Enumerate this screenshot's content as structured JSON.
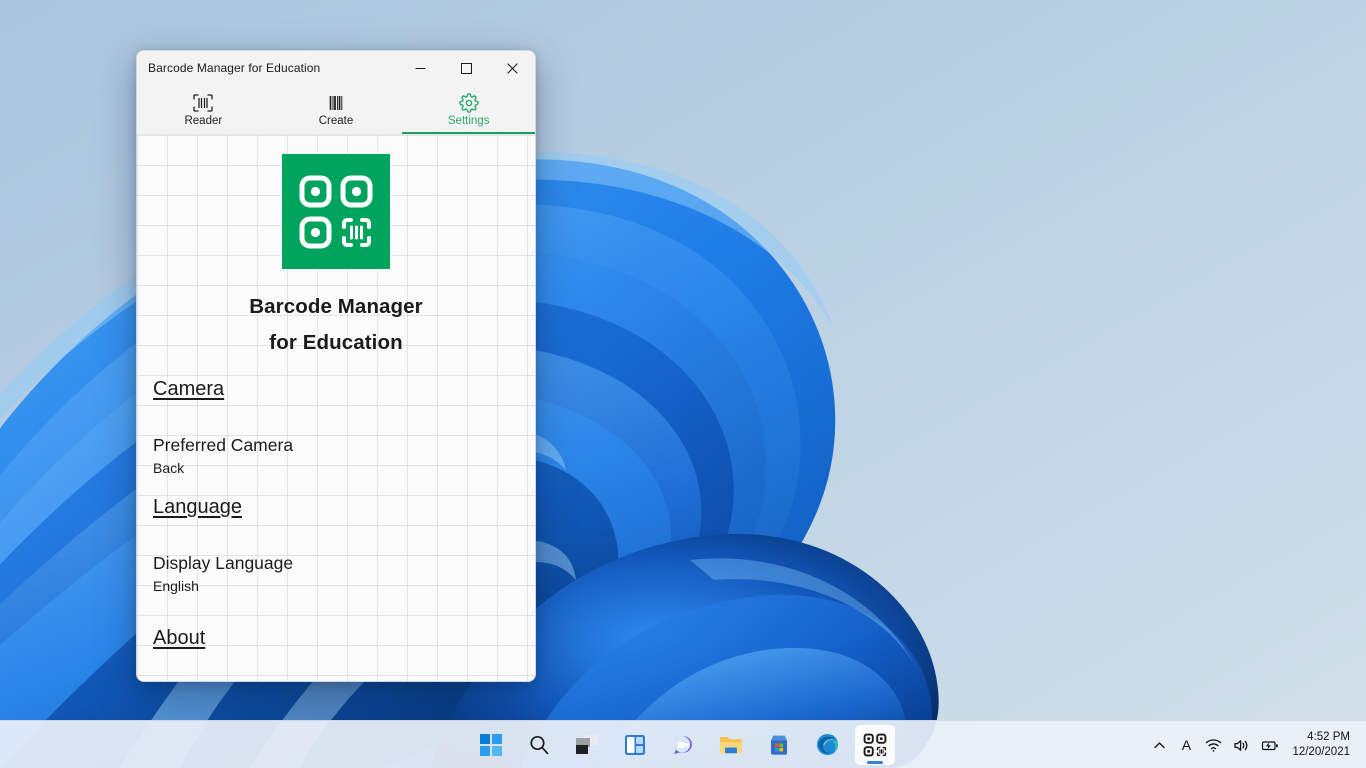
{
  "window": {
    "title": "Barcode Manager for Education",
    "controls": {
      "minimize": "Minimize",
      "maximize": "Maximize",
      "close": "Close"
    },
    "tabs": [
      {
        "label": "Reader",
        "icon": "barcode-scan-icon",
        "active": false
      },
      {
        "label": "Create",
        "icon": "barcode-icon",
        "active": false
      },
      {
        "label": "Settings",
        "icon": "gear-icon",
        "active": true
      }
    ],
    "accent_color": "#1f9d62",
    "logo_color": "#00a45d"
  },
  "settings": {
    "app_name_line1": "Barcode Manager",
    "app_name_line2": "for Education",
    "sections": [
      {
        "heading": "Camera",
        "items": [
          {
            "title": "Preferred Camera",
            "value": "Back"
          }
        ]
      },
      {
        "heading": "Language",
        "items": [
          {
            "title": "Display Language",
            "value": "English"
          }
        ]
      },
      {
        "heading": "About",
        "items": []
      }
    ]
  },
  "taskbar": {
    "items": [
      {
        "name": "start",
        "label": "Start",
        "active": false
      },
      {
        "name": "search",
        "label": "Search",
        "active": false
      },
      {
        "name": "task-view",
        "label": "Task View",
        "active": false
      },
      {
        "name": "widgets",
        "label": "Widgets",
        "active": false
      },
      {
        "name": "chat",
        "label": "Chat",
        "active": false
      },
      {
        "name": "file-explorer",
        "label": "File Explorer",
        "active": false
      },
      {
        "name": "store",
        "label": "Microsoft Store",
        "active": false
      },
      {
        "name": "edge",
        "label": "Microsoft Edge",
        "active": false
      },
      {
        "name": "barcode-app",
        "label": "Barcode Manager for Education",
        "active": true
      }
    ],
    "tray": [
      {
        "name": "show-hidden-icons",
        "label": "Show hidden icons"
      },
      {
        "name": "input-indicator",
        "label": "A"
      },
      {
        "name": "network",
        "label": "Network"
      },
      {
        "name": "volume",
        "label": "Volume"
      },
      {
        "name": "battery",
        "label": "Battery"
      }
    ],
    "clock": {
      "time": "4:52 PM",
      "date": "12/20/2021"
    }
  }
}
